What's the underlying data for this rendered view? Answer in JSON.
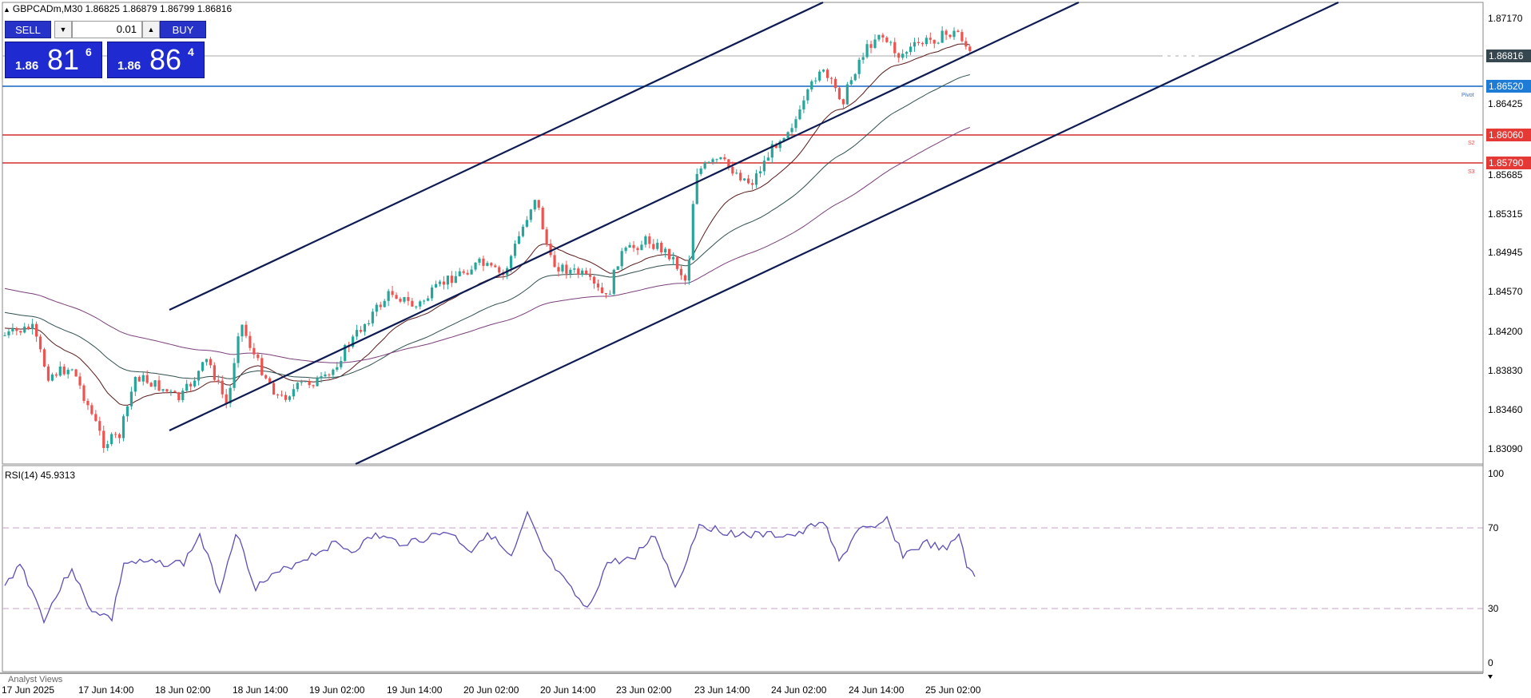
{
  "header": {
    "symbol_line": "GBPCADm,M30  1.86825 1.86879 1.86799 1.86816"
  },
  "trade_panel": {
    "sell_label": "SELL",
    "buy_label": "BUY",
    "lot_value": "0.01",
    "bid": {
      "prefix": "1.86",
      "big": "81",
      "sup": "6"
    },
    "ask": {
      "prefix": "1.86",
      "big": "86",
      "sup": "4"
    }
  },
  "price_axis": {
    "ticks": [
      "1.87170",
      "1.86816",
      "1.86520",
      "1.86425",
      "1.86060",
      "1.85790",
      "1.85685",
      "1.85315",
      "1.84945",
      "1.84570",
      "1.84200",
      "1.83830",
      "1.83460",
      "1.83090"
    ]
  },
  "tags": {
    "current": "1.86816",
    "pivot": "1.86520",
    "s2": "1.86060",
    "s3": "1.85790"
  },
  "level_labels": {
    "pivot": "Pivot",
    "s2": "S2",
    "s3": "S3"
  },
  "rsi": {
    "label": "RSI(14) 45.9313",
    "ticks": [
      "100",
      "70",
      "30",
      "0"
    ]
  },
  "time_axis": {
    "labels": [
      "17 Jun 2025",
      "17 Jun 14:00",
      "18 Jun 02:00",
      "18 Jun 14:00",
      "19 Jun 02:00",
      "19 Jun 14:00",
      "20 Jun 02:00",
      "20 Jun 14:00",
      "23 Jun 02:00",
      "23 Jun 14:00",
      "24 Jun 02:00",
      "24 Jun 14:00",
      "25 Jun 02:00"
    ]
  },
  "analyst_views": "Analyst Views",
  "colors": {
    "bull": "#26a69a",
    "bear": "#ef5350",
    "pivot": "#1565c0",
    "support": "#d32f2f",
    "channel": "#0d1b52",
    "rsi_line": "#5b4fb5"
  }
}
